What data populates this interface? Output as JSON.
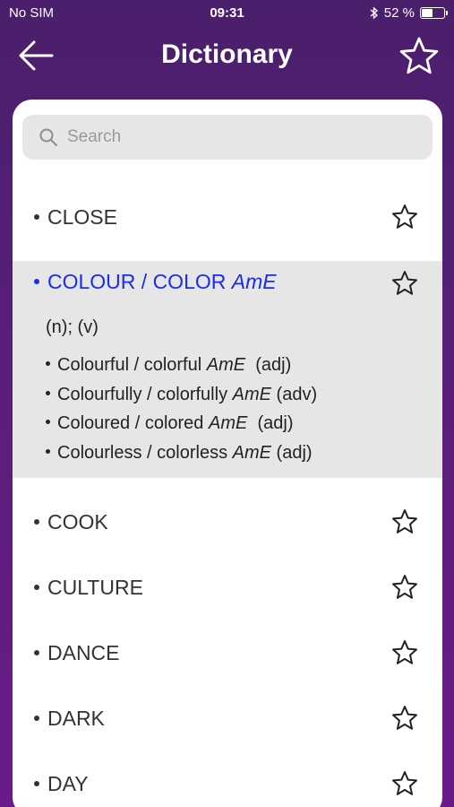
{
  "status_bar": {
    "carrier": "No SIM",
    "time": "09:31",
    "battery": "52 %",
    "battery_level": 0.52
  },
  "header": {
    "title": "Dictionary"
  },
  "search": {
    "placeholder": "Search"
  },
  "entries": [
    {
      "word": "CLOSE"
    },
    {
      "word": "COOK"
    },
    {
      "word": "CULTURE"
    },
    {
      "word": "DANCE"
    },
    {
      "word": "DARK"
    },
    {
      "word": "DAY"
    }
  ],
  "expanded": {
    "word": "COLOUR / COLOR",
    "word_suffix": "AmE",
    "pos": "(n); (v)",
    "derived": [
      {
        "text": "Colourful / colorful",
        "suffix": "AmE",
        "pos": "(adj)"
      },
      {
        "text": "Colourfully / colorfully",
        "suffix": "AmE",
        "pos": "(adv)"
      },
      {
        "text": "Coloured / colored",
        "suffix": "AmE",
        "pos": "(adj)"
      },
      {
        "text": "Colourless / colorless",
        "suffix": "AmE",
        "pos": "(adj)"
      }
    ]
  },
  "colors": {
    "accent": "#1a2cf0",
    "header_bg": "#5a1f7a",
    "expanded_bg": "#e6e6e6"
  }
}
